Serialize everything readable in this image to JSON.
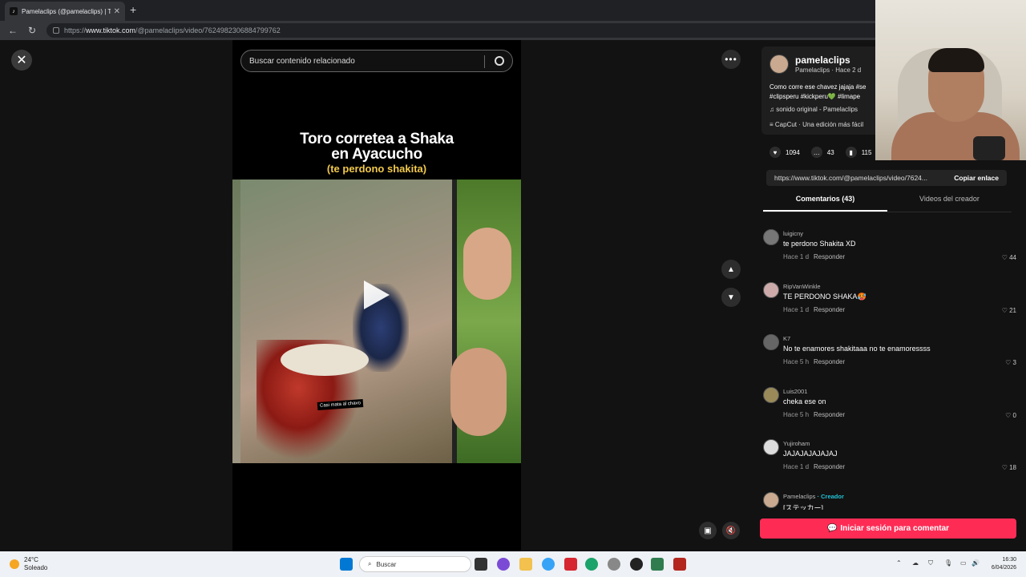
{
  "browser": {
    "tab_title": "Pamelaclips (@pamelaclips) | TikTo",
    "new_tab": "+",
    "url_prefix": "https://",
    "url_host": "www.tiktok.com",
    "url_path": "/@pamelaclips/video/7624982306884799762"
  },
  "viewer": {
    "search_placeholder": "Buscar contenido relacionado",
    "video_title_line1": "Toro corretea a Shaka",
    "video_title_line2": "en Ayacucho",
    "video_subtitle": "(te perdono shakita)",
    "video_caption": "Casi mata al chavo"
  },
  "post": {
    "username": "pamelaclips",
    "sub": "Pamelaclips · Hace 2 d",
    "desc_line1": "Como corre ese chavez jajaja #se",
    "desc_line2": "#clipsperu #kickperu💚 #limape",
    "music": "♫  sonido original - Pamelaclips",
    "capcut": "CapCut · Una edición más fácil",
    "likes": "1094",
    "comments_count": "43",
    "saves": "115",
    "link": "https://www.tiktok.com/@pamelaclips/video/7624...",
    "copy_label": "Copiar enlace"
  },
  "tabs": {
    "comments": "Comentarios (43)",
    "creator_videos": "Videos del creador"
  },
  "comments": [
    {
      "user": "luigicny",
      "text": "te perdono Shakita XD",
      "time": "Hace 1 d",
      "reply": "Responder",
      "likes": "44"
    },
    {
      "user": "RipVanWinkle",
      "text": "TE PERDONO SHAKA🥵",
      "time": "Hace 1 d",
      "reply": "Responder",
      "likes": "21"
    },
    {
      "user": "K7",
      "text": "No te enamores shakitaaa no te enamoressss",
      "time": "Hace 5 h",
      "reply": "Responder",
      "likes": "3"
    },
    {
      "user": "Luis2001",
      "text": "cheka ese on",
      "time": "Hace 5 h",
      "reply": "Responder",
      "likes": "0"
    },
    {
      "user": "Yujiroham",
      "text": "JAJAJAJAJAJAJ",
      "time": "Hace 1 d",
      "reply": "Responder",
      "likes": "18"
    },
    {
      "user": "Pamelaclips",
      "creator": "· Creador",
      "text": "[ステッカー]",
      "time": "",
      "reply": "",
      "likes": ""
    }
  ],
  "login_button": "Iniciar sesión para comentar",
  "taskbar": {
    "temp": "24°C",
    "weather": "Soleado",
    "search": "Buscar",
    "time": "16:30",
    "date": "6/04/2026"
  },
  "icons": [
    "close-icon",
    "search-icon",
    "more-icon",
    "chevron-up-icon",
    "chevron-down-icon",
    "heart-icon",
    "comment-icon",
    "bookmark-icon",
    "mute-icon",
    "windows-icon"
  ]
}
